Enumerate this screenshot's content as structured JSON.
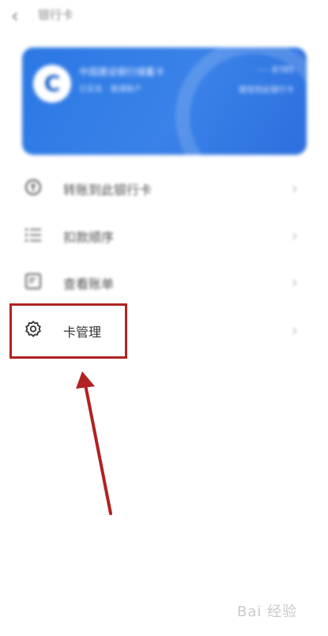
{
  "header": {
    "back_icon": "chevron-left-icon",
    "title": "银行卡"
  },
  "card": {
    "logo_text": "C",
    "bank_name": "中国建设银行储蓄卡",
    "subtitle": "已实名 · 普通账户",
    "number": "···· 8785",
    "action": "提现到此银行卡"
  },
  "menu": {
    "items": [
      {
        "icon": "transfer-icon",
        "label": "转账到此银行卡"
      },
      {
        "icon": "list-icon",
        "label": "扣款顺序"
      },
      {
        "icon": "bill-icon",
        "label": "查看账单"
      },
      {
        "icon": "gear-icon",
        "label": "卡管理"
      }
    ]
  },
  "annotation": {
    "highlight_color": "#b02222",
    "arrow_color": "#b02222"
  },
  "watermark": "Bai 经验"
}
